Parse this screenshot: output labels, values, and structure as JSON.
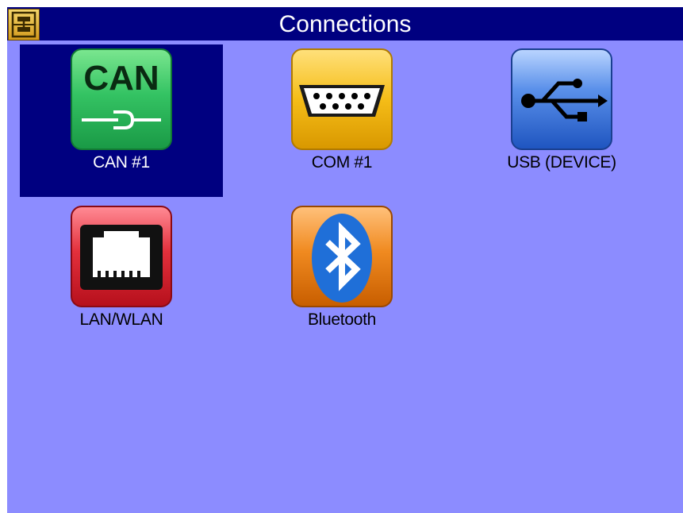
{
  "title_bar": {
    "title": "Connections",
    "app_icon": "network-settings-icon"
  },
  "connections": [
    {
      "label": "CAN #1",
      "icon": "can-bus-icon",
      "icon_text": "CAN",
      "selected": true
    },
    {
      "label": "COM #1",
      "icon": "serial-port-icon",
      "selected": false
    },
    {
      "label": "USB (DEVICE)",
      "icon": "usb-icon",
      "selected": false
    },
    {
      "label": "LAN/WLAN",
      "icon": "ethernet-port-icon",
      "selected": false
    },
    {
      "label": "Bluetooth",
      "icon": "bluetooth-icon",
      "selected": false
    }
  ],
  "colors": {
    "background": "#8c8cff",
    "title_bar": "#000080",
    "selection": "#000080",
    "can_icon": "#2fbf5a",
    "com_icon": "#f0b400",
    "usb_icon": "#2f6fd0",
    "lan_icon": "#e0303a",
    "bluetooth_icon": "#e07a10"
  }
}
